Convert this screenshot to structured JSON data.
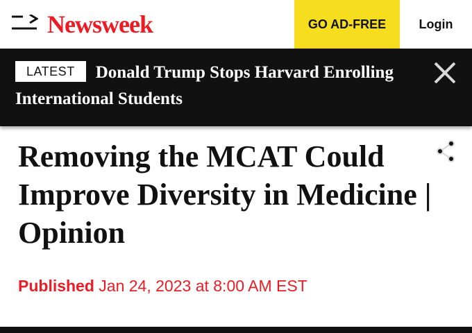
{
  "header": {
    "logo": "Newsweek",
    "ad_free_label": "GO AD-FREE",
    "login_label": "Login"
  },
  "banner": {
    "badge": "LATEST",
    "headline": "Donald Trump Stops Harvard Enrolling International Students"
  },
  "article": {
    "title": "Removing the MCAT Could Improve Diversity in Medicine | Opinion",
    "published_label": "Published",
    "published_date": "Jan 24, 2023 at 8:00 AM EST"
  },
  "colors": {
    "brand_red": "#ec1c24",
    "ad_free_yellow": "#f6dd1e",
    "banner_black": "#111111"
  },
  "icons": {
    "menu": "menu-icon",
    "close": "close-icon",
    "share": "share-icon"
  }
}
